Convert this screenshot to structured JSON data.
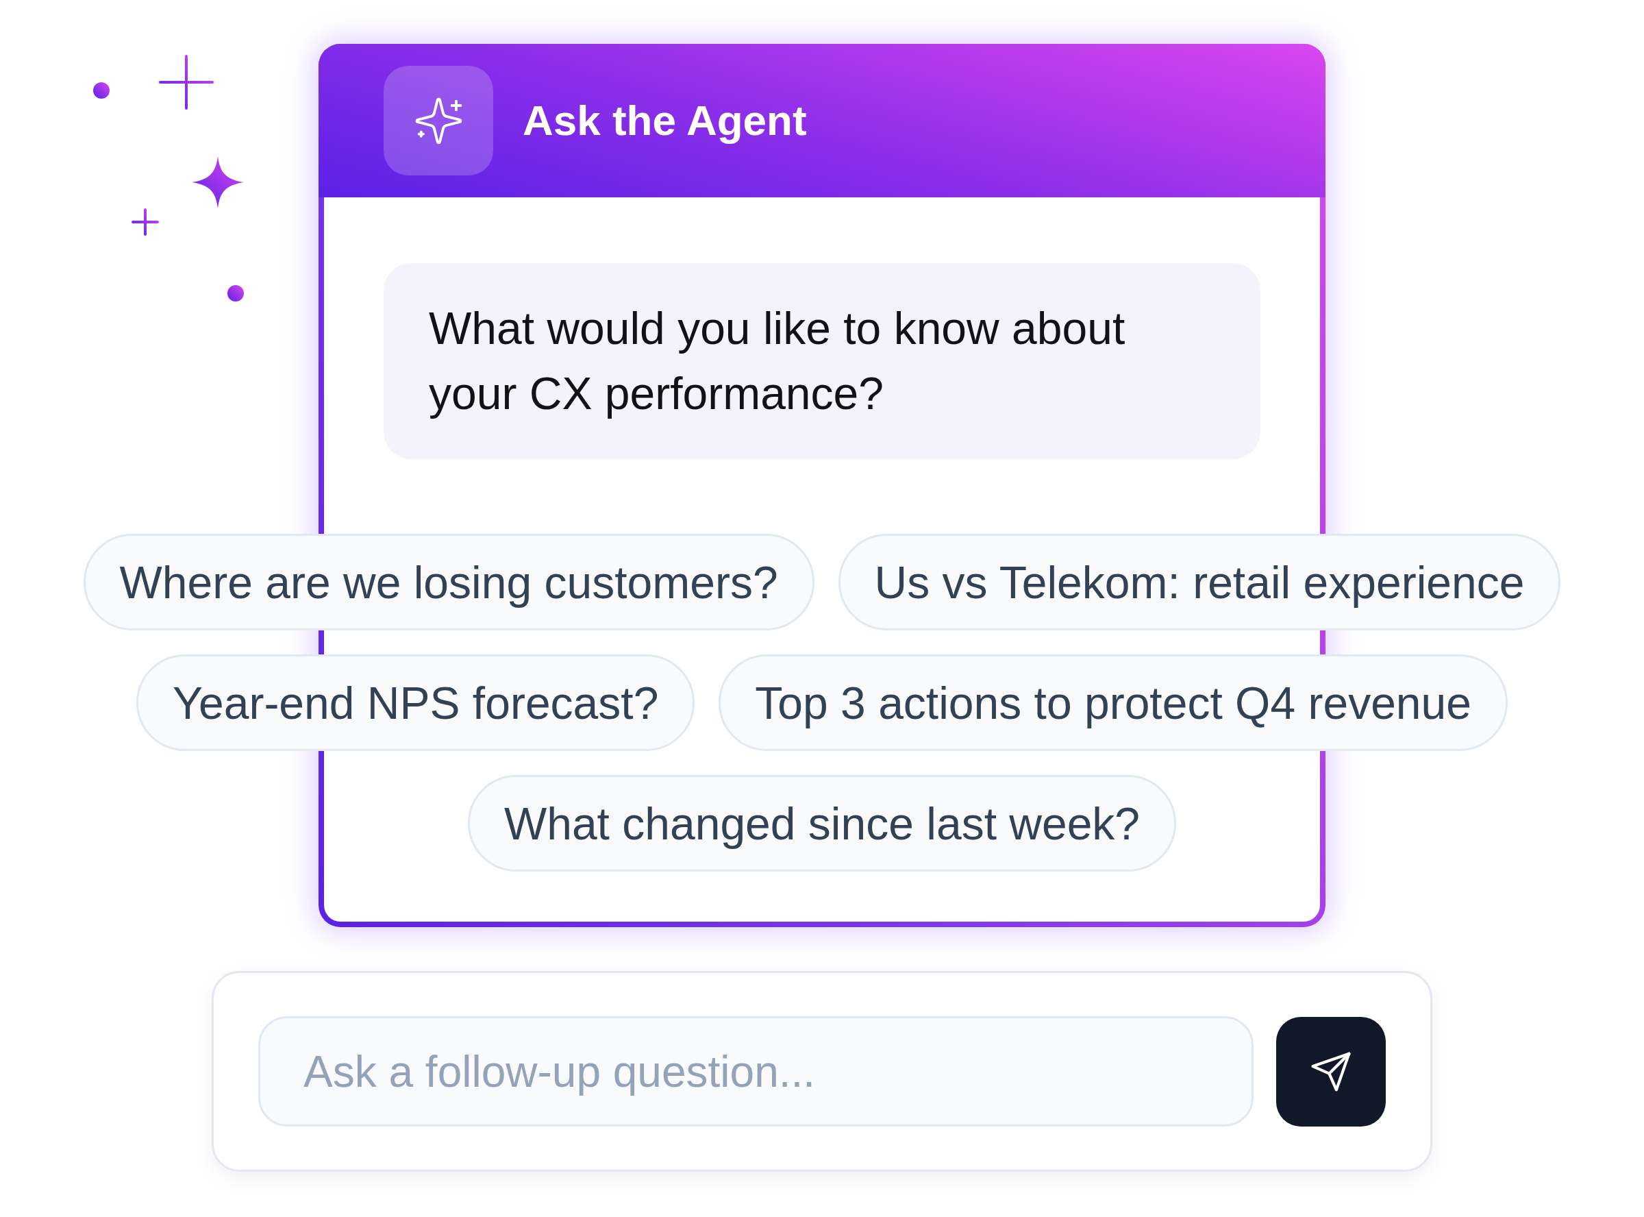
{
  "header": {
    "title": "Ask the Agent"
  },
  "message": {
    "text": "What would you like to know about your CX performance?"
  },
  "suggestions": [
    {
      "label": "Where are we losing customers?"
    },
    {
      "label": "Us vs Telekom: retail experience"
    },
    {
      "label": "Year-end NPS forecast?"
    },
    {
      "label": "Top 3 actions to protect Q4 revenue"
    },
    {
      "label": "What changed since last week?"
    }
  ],
  "composer": {
    "placeholder": "Ask a follow-up question..."
  }
}
